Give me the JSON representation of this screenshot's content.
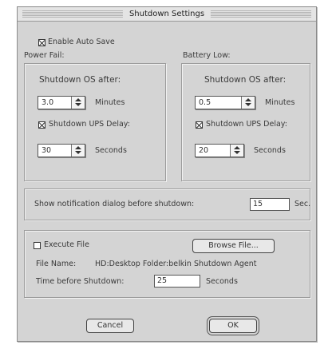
{
  "window": {
    "title": "Shutdown Settings"
  },
  "auto_save": {
    "label": "Enable Auto Save",
    "checked": true
  },
  "power_fail": {
    "heading": "Power Fail:",
    "shutdown_label": "Shutdown OS after:",
    "delay_value": "3.0",
    "delay_unit": "Minutes",
    "ups_delay_label": "Shutdown UPS Delay:",
    "ups_delay_checked": true,
    "ups_delay_value": "30",
    "ups_delay_unit": "Seconds"
  },
  "battery_low": {
    "heading": "Battery Low:",
    "shutdown_label": "Shutdown OS after:",
    "delay_value": "0.5",
    "delay_unit": "Minutes",
    "ups_delay_label": "Shutdown UPS Delay:",
    "ups_delay_checked": true,
    "ups_delay_value": "20",
    "ups_delay_unit": "Seconds"
  },
  "notification": {
    "label": "Show notification dialog before shutdown:",
    "value": "15",
    "unit": "Sec."
  },
  "execute": {
    "label": "Execute File",
    "checked": false,
    "browse_label": "Browse File...",
    "file_name_label": "File Name:",
    "file_name_value": "HD:Desktop Folder:belkin Shutdown Agent",
    "time_label": "Time before Shutdown:",
    "time_value": "25",
    "time_unit": "Seconds"
  },
  "buttons": {
    "cancel": "Cancel",
    "ok": "OK"
  }
}
